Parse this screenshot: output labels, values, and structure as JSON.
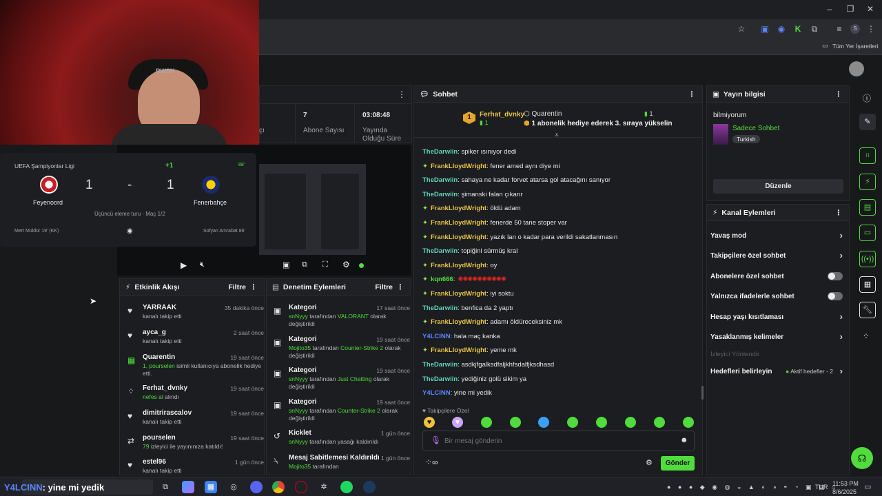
{
  "browser": {
    "bookmarks_label": "Tüm Yer İşaretleri",
    "profile_letter": "S"
  },
  "webcam": {
    "hat_text": "RWSH"
  },
  "score": {
    "competition": "UEFA Şampiyonlar Ligi",
    "plus": "+1",
    "minute": "88'",
    "home_team": "Feyenoord",
    "away_team": "Fenerbahçe",
    "home_score": "1",
    "separator": "-",
    "away_score": "1",
    "round": "Üçüncü eleme turu · Maç 1/2",
    "home_event": "Mert Müldür 19' (KK)",
    "away_event": "Sofyan Amrabat 86'"
  },
  "stats": {
    "partial_label": "çı",
    "subs_count": "7",
    "subs_label": "Abone Sayısı",
    "uptime": "03:08:48",
    "uptime_label_1": "Yayında",
    "uptime_label_2": "Olduğu Süre"
  },
  "activity": {
    "title": "Etkinlik Akışı",
    "filter": "Filtre",
    "items": [
      {
        "name": "YARRAAK",
        "time": "35 dakika önce",
        "desc": "kanalı takip etti",
        "hl": ""
      },
      {
        "name": "ayca_g",
        "time": "2 saat önce",
        "desc": "kanalı takip etti",
        "hl": ""
      },
      {
        "name": "Quarentin",
        "time": "19 saat önce",
        "hl": "1, pourselen",
        "desc": " isimli kullanıcıya abonelik hediye etti."
      },
      {
        "name": "Ferhat_dvnky",
        "time": "19 saat önce",
        "hl": "nefes al",
        "desc": " alındı"
      },
      {
        "name": "dimitrirascalov",
        "time": "19 saat önce",
        "desc": "kanalı takip etti",
        "hl": ""
      },
      {
        "name": "pourselen",
        "time": "19 saat önce",
        "hl": "79",
        "desc": " izleyici ile yayınınıza katıldı!"
      },
      {
        "name": "estel96",
        "time": "1 gün önce",
        "desc": "kanalı takip etti",
        "hl": ""
      }
    ]
  },
  "moderation": {
    "title": "Denetim Eylemleri",
    "filter": "Filtre",
    "items": [
      {
        "title": "Kategori",
        "time": "17 saat önce",
        "user": "snNyyy",
        "mid": " tarafından ",
        "hl": "VALORANT",
        "rest": " olarak değiştirildi"
      },
      {
        "title": "Kategori",
        "time": "19 saat önce",
        "user": "Mojito35",
        "mid": " tarafından ",
        "hl": "Counter-Strike 2",
        "rest": " olarak değiştirildi"
      },
      {
        "title": "Kategori",
        "time": "19 saat önce",
        "user": "snNyyy",
        "mid": " tarafından ",
        "hl": "Just Chatting",
        "rest": " olarak değiştirildi"
      },
      {
        "title": "Kategori",
        "time": "19 saat önce",
        "user": "snNyyy",
        "mid": " tarafından ",
        "hl": "Counter-Strike 2",
        "rest": " olarak değiştirildi"
      },
      {
        "title": "Kicklet",
        "time": "1 gün önce",
        "user": "snNyyy",
        "mid": " tarafından yasağı kaldırıldı",
        "hl": "",
        "rest": ""
      },
      {
        "title": "Mesaj Sabitlemesi Kaldırıldı",
        "time": "1 gün önce",
        "user": "Mojito35",
        "mid": " tarafından",
        "hl": "",
        "rest": ""
      }
    ]
  },
  "chat": {
    "title": "Sohbet",
    "top_user": "Ferhat_dvnky",
    "top_user_count": "1",
    "top_rank": "1",
    "gifter": "Quarentin",
    "gifter_count": "1",
    "gift_text": "1 abonelik hediye ederek 3. sıraya yükselin",
    "messages": [
      {
        "user": "TheDarwiin",
        "cls": "teal",
        "badge": false,
        "text": ": spiker ısınıyor dedi"
      },
      {
        "user": "FrankLloydWright",
        "cls": "gold",
        "badge": true,
        "text": ": fener amed aynı diye mi"
      },
      {
        "user": "TheDarwiin",
        "cls": "teal",
        "badge": false,
        "text": ": sahaya ne kadar forvet atarsa gol atacağını sanıyor"
      },
      {
        "user": "TheDarwiin",
        "cls": "teal",
        "badge": false,
        "text": ": şimanski falan çıkarır"
      },
      {
        "user": "FrankLloydWright",
        "cls": "gold",
        "badge": true,
        "text": ": öldü adam"
      },
      {
        "user": "FrankLloydWright",
        "cls": "gold",
        "badge": true,
        "text": ": fenerde 50 tane stoper var"
      },
      {
        "user": "FrankLloydWright",
        "cls": "gold",
        "badge": true,
        "text": ": yazık lan o kadar para verildi sakatlanmasın"
      },
      {
        "user": "TheDarwiin",
        "cls": "teal",
        "badge": false,
        "text": ": topiğini sürmüş kral"
      },
      {
        "user": "FrankLloydWright",
        "cls": "gold",
        "badge": true,
        "text": ": oy"
      },
      {
        "user": "kqn666",
        "cls": "green",
        "badge": true,
        "text": ":"
      },
      {
        "user": "FrankLloydWright",
        "cls": "gold",
        "badge": true,
        "text": ": iyi soktu"
      },
      {
        "user": "TheDarwiin",
        "cls": "teal",
        "badge": false,
        "text": ": benfica da 2 yaptı"
      },
      {
        "user": "FrankLloydWright",
        "cls": "gold",
        "badge": true,
        "text": ": adamı öldüreceksiniz mk"
      },
      {
        "user": "Y4LCINN",
        "cls": "blue",
        "badge": false,
        "text": ": hala maç kanka"
      },
      {
        "user": "FrankLloydWright",
        "cls": "gold",
        "badge": true,
        "text": ": yeme mk"
      },
      {
        "user": "TheDarwiin",
        "cls": "teal",
        "badge": false,
        "text": ": asdkjfgalksdfaljkhfsdalfjksdhasd"
      },
      {
        "user": "TheDarwiin",
        "cls": "teal",
        "badge": false,
        "text": ": yediğiniz golü sikim ya"
      },
      {
        "user": "Y4LCINN",
        "cls": "blue",
        "badge": false,
        "text": ": yine mi yedik"
      }
    ],
    "followers_only": "Takipçilere Özel",
    "input_placeholder": "Bir mesaj gönderin",
    "send": "Gönder"
  },
  "stream_info": {
    "title": "Yayın bilgisi",
    "stream_title": "bilmiyorum",
    "category": "Sadece Sohbet",
    "language": "Turkish",
    "edit": "Düzenle"
  },
  "channel_actions": {
    "title": "Kanal Eylemleri",
    "rows": [
      {
        "label": "Yavaş mod",
        "kind": "chevron"
      },
      {
        "label": "Takipçilere özel sohbet",
        "kind": "chevron"
      },
      {
        "label": "Abonelere özel sohbet",
        "kind": "toggle"
      },
      {
        "label": "Yalnızca ifadelerle sohbet",
        "kind": "toggle"
      },
      {
        "label": "Hesap yaşı kısıtlaması",
        "kind": "chevron"
      },
      {
        "label": "Yasaklanmış kelimeler",
        "kind": "chevron"
      }
    ],
    "disabled_label": "İzleyici Yönlendir",
    "goals_label": "Hedefleri belirleyin",
    "goals_status": "Aktif hedefler - 2"
  },
  "taskbar": {
    "overlay_name": "Y4LCINN",
    "overlay_text": ": yine mi yedik",
    "lang": "TUR",
    "time": "11:53 PM",
    "date": "8/6/2025"
  },
  "colors": {
    "accent": "#4fdc3c",
    "background": "#18191b",
    "panel": "#1c1d20"
  }
}
